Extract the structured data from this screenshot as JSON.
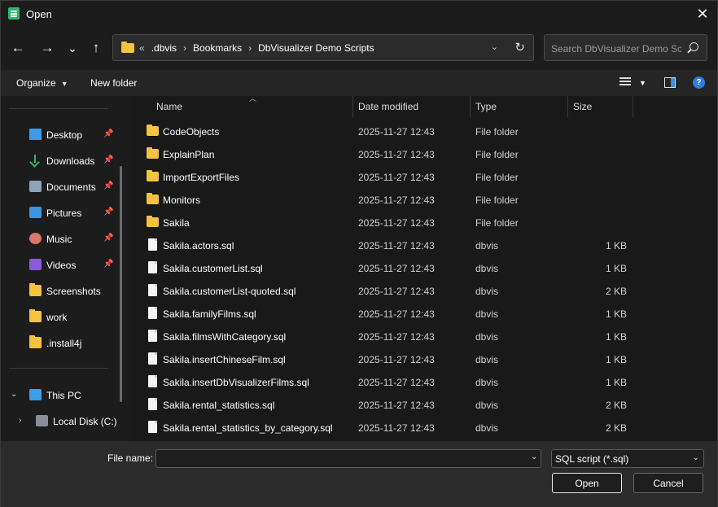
{
  "window": {
    "title": "Open",
    "close_glyph": "✕"
  },
  "nav": {
    "back_glyph": "←",
    "forward_glyph": "→",
    "recent_glyph": "⌄",
    "up_glyph": "↑",
    "breadcrumb_overflow": "«",
    "breadcrumbs": [
      ".dbvis",
      "Bookmarks",
      "DbVisualizer Demo Scripts"
    ],
    "separator": "›",
    "search_placeholder": "Search DbVisualizer Demo Scripts"
  },
  "commands": {
    "organize": "Organize",
    "new_folder": "New folder",
    "help": "?"
  },
  "sidebar": {
    "quick_access": [
      {
        "label": "Desktop",
        "icon": "desktop-icon",
        "pinned": true
      },
      {
        "label": "Downloads",
        "icon": "download-icon",
        "pinned": true
      },
      {
        "label": "Documents",
        "icon": "documents-icon",
        "pinned": true
      },
      {
        "label": "Pictures",
        "icon": "pictures-icon",
        "pinned": true
      },
      {
        "label": "Music",
        "icon": "music-icon",
        "pinned": true
      },
      {
        "label": "Videos",
        "icon": "videos-icon",
        "pinned": true
      },
      {
        "label": "Screenshots",
        "icon": "folder-icon",
        "pinned": false
      },
      {
        "label": "work",
        "icon": "folder-icon",
        "pinned": false
      },
      {
        "label": ".install4j",
        "icon": "folder-icon",
        "pinned": false
      }
    ],
    "this_pc": {
      "label": "This PC",
      "expanded": true
    },
    "local_disk": {
      "label": "Local Disk (C:)",
      "expanded": false
    }
  },
  "columns": {
    "name": "Name",
    "date": "Date modified",
    "type": "Type",
    "size": "Size"
  },
  "files": [
    {
      "name": "CodeObjects",
      "date": "2025-11-27 12:43",
      "type": "File folder",
      "size": "",
      "kind": "folder"
    },
    {
      "name": "ExplainPlan",
      "date": "2025-11-27 12:43",
      "type": "File folder",
      "size": "",
      "kind": "folder"
    },
    {
      "name": "ImportExportFiles",
      "date": "2025-11-27 12:43",
      "type": "File folder",
      "size": "",
      "kind": "folder"
    },
    {
      "name": "Monitors",
      "date": "2025-11-27 12:43",
      "type": "File folder",
      "size": "",
      "kind": "folder"
    },
    {
      "name": "Sakila",
      "date": "2025-11-27 12:43",
      "type": "File folder",
      "size": "",
      "kind": "folder"
    },
    {
      "name": "Sakila.actors.sql",
      "date": "2025-11-27 12:43",
      "type": "dbvis",
      "size": "1 KB",
      "kind": "file"
    },
    {
      "name": "Sakila.customerList.sql",
      "date": "2025-11-27 12:43",
      "type": "dbvis",
      "size": "1 KB",
      "kind": "file"
    },
    {
      "name": "Sakila.customerList-quoted.sql",
      "date": "2025-11-27 12:43",
      "type": "dbvis",
      "size": "2 KB",
      "kind": "file"
    },
    {
      "name": "Sakila.familyFilms.sql",
      "date": "2025-11-27 12:43",
      "type": "dbvis",
      "size": "1 KB",
      "kind": "file"
    },
    {
      "name": "Sakila.filmsWithCategory.sql",
      "date": "2025-11-27 12:43",
      "type": "dbvis",
      "size": "1 KB",
      "kind": "file"
    },
    {
      "name": "Sakila.insertChineseFilm.sql",
      "date": "2025-11-27 12:43",
      "type": "dbvis",
      "size": "1 KB",
      "kind": "file"
    },
    {
      "name": "Sakila.insertDbVisualizerFilms.sql",
      "date": "2025-11-27 12:43",
      "type": "dbvis",
      "size": "1 KB",
      "kind": "file"
    },
    {
      "name": "Sakila.rental_statistics.sql",
      "date": "2025-11-27 12:43",
      "type": "dbvis",
      "size": "2 KB",
      "kind": "file"
    },
    {
      "name": "Sakila.rental_statistics_by_category.sql",
      "date": "2025-11-27 12:43",
      "type": "dbvis",
      "size": "2 KB",
      "kind": "file"
    }
  ],
  "footer": {
    "file_name_label": "File name:",
    "file_name_value": "",
    "filter_value": "SQL script (*.sql)",
    "open_label": "Open",
    "cancel_label": "Cancel"
  },
  "colors": {
    "folder": "#f5c242",
    "accent": "#2f7fd8",
    "background": "#1c1c1c"
  }
}
